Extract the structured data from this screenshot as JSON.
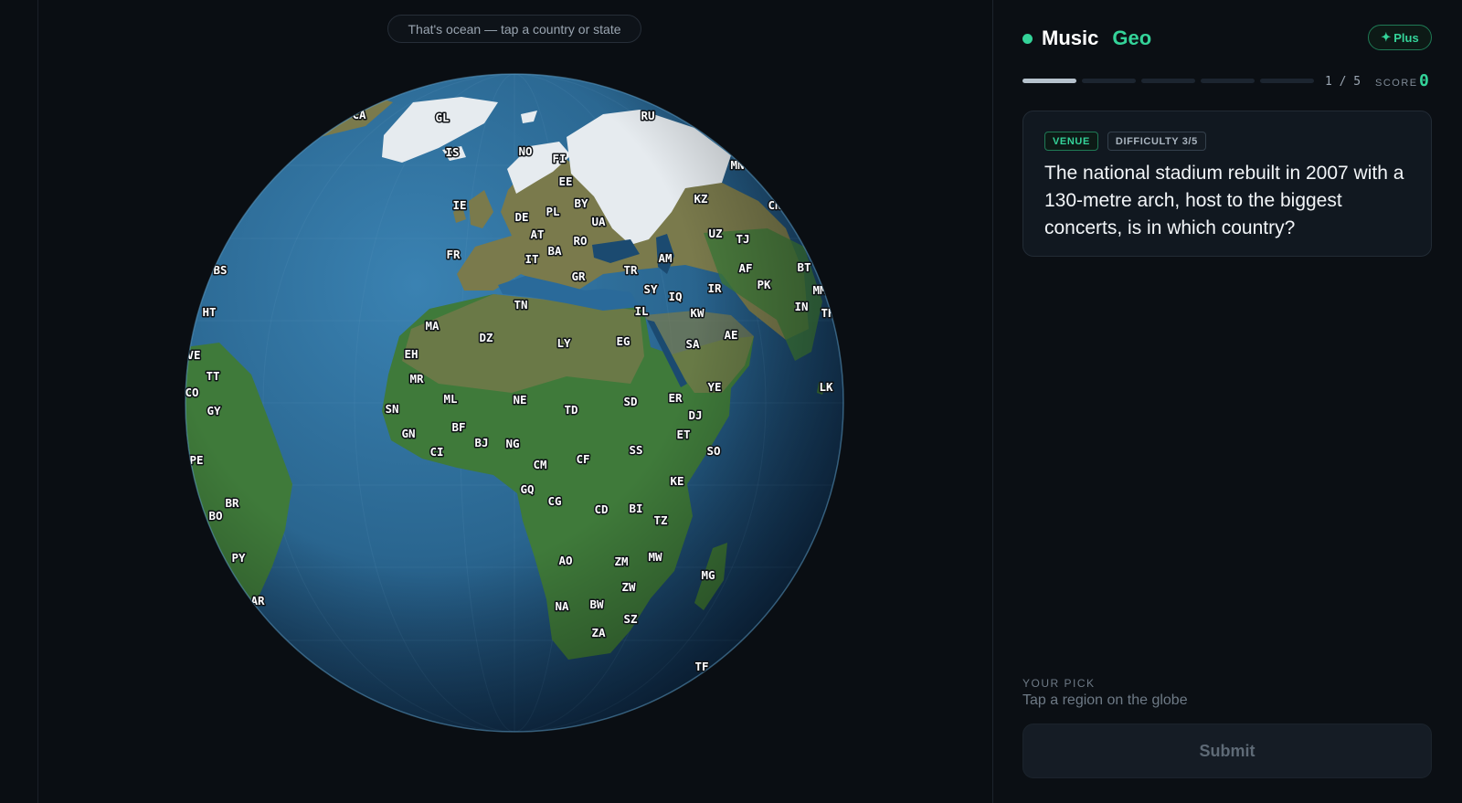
{
  "toast": {
    "text": "That's ocean — tap a country or state"
  },
  "brand": {
    "primary": "Music",
    "secondary": "Geo"
  },
  "plus_button": {
    "icon": "sparkle-icon",
    "icon_glyph": "✦",
    "label": "Plus"
  },
  "progress": {
    "current": 1,
    "total": 5,
    "text": "1 / 5"
  },
  "score": {
    "label": "SCORE",
    "value": "0"
  },
  "question": {
    "category_tag": "VENUE",
    "difficulty_tag": "DIFFICULTY 3/5",
    "text": "The national stadium rebuilt in 2007 with a 130-metre arch, host to the biggest concerts, is in which country?"
  },
  "pick": {
    "label": "YOUR PICK",
    "value": "Tap a region on the globe"
  },
  "submit": {
    "label": "Submit"
  },
  "globe": {
    "country_labels": [
      "GL",
      "RU",
      "CA",
      "IS",
      "NO",
      "FI",
      "MN",
      "EE",
      "IE",
      "BY",
      "KZ",
      "CN",
      "DE",
      "PL",
      "UA",
      "AT",
      "RO",
      "UZ",
      "TJ",
      "BA",
      "FR",
      "IT",
      "AM",
      "BS",
      "GR",
      "TR",
      "AF",
      "BT",
      "SY",
      "IQ",
      "IR",
      "PK",
      "MM",
      "TN",
      "IL",
      "KW",
      "IN",
      "TH",
      "HT",
      "MA",
      "DZ",
      "LY",
      "EG",
      "SA",
      "AE",
      "EH",
      "VE",
      "TT",
      "MR",
      "YE",
      "LK",
      "CO",
      "ML",
      "NE",
      "SN",
      "TD",
      "SD",
      "ER",
      "GY",
      "DJ",
      "GN",
      "BF",
      "ET",
      "BJ",
      "NG",
      "CI",
      "SS",
      "SO",
      "CF",
      "CM",
      "PE",
      "KE",
      "GQ",
      "CG",
      "BR",
      "CD",
      "BI",
      "BO",
      "TZ",
      "AO",
      "ZM",
      "MW",
      "PY",
      "MG",
      "ZW",
      "AR",
      "NA",
      "BW",
      "SZ",
      "ZA",
      "TF"
    ]
  },
  "colors": {
    "accent": "#34d399",
    "background": "#0b0f14",
    "ocean": "#2a6a9a",
    "land_green": "#3f7a3a",
    "land_olive": "#7a7a4c",
    "ice": "#e6ebef"
  }
}
